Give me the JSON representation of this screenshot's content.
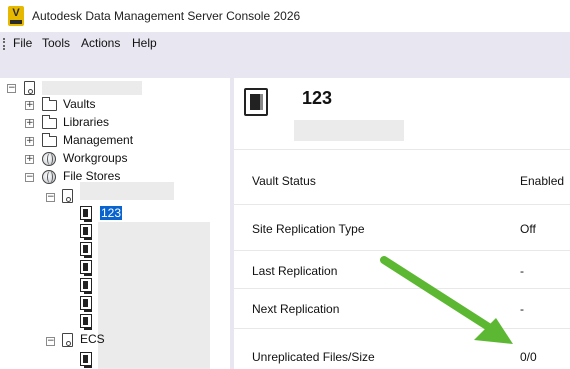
{
  "window": {
    "title": "Autodesk Data Management Server Console 2026",
    "logo_letter": "V"
  },
  "menu": {
    "items": [
      "File",
      "Tools",
      "Actions",
      "Help"
    ]
  },
  "tree": {
    "vaults": "Vaults",
    "libraries": "Libraries",
    "management": "Management",
    "workgroups": "Workgroups",
    "file_stores": "File Stores",
    "selected_store": "123",
    "other_store_prefix": "ECS",
    "expand_glyph": "+",
    "collapse_glyph": "−"
  },
  "detail": {
    "title": "123",
    "properties": [
      {
        "label": "Vault Status",
        "value": "Enabled"
      },
      {
        "label": "Site Replication Type",
        "value": "Off"
      },
      {
        "label": "Last Replication",
        "value": "-"
      },
      {
        "label": "Next Replication",
        "value": "-"
      },
      {
        "label": "Unreplicated Files/Size",
        "value": "0/0"
      }
    ]
  },
  "colors": {
    "accent": "#0a64d0",
    "arrow": "#5cb832",
    "menubar": "#e8e6f0",
    "logo": "#e6b800"
  }
}
